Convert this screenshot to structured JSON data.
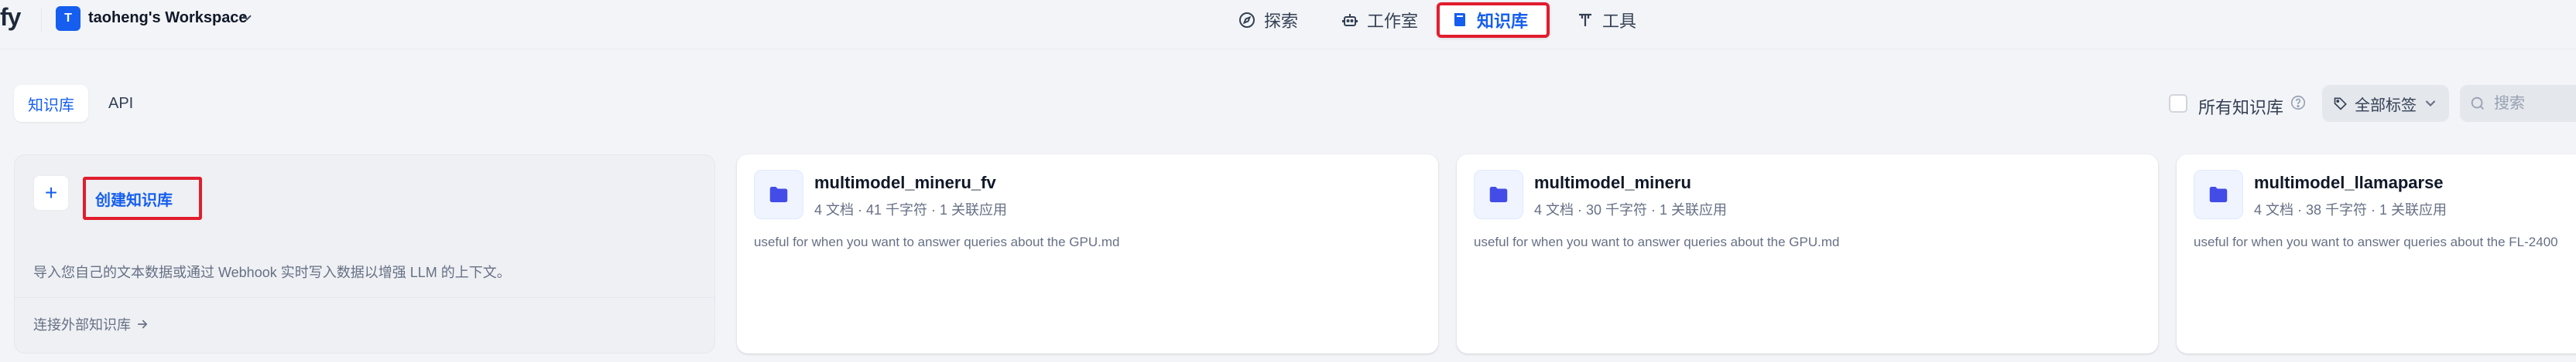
{
  "app": {
    "logo_text": "fy"
  },
  "workspace": {
    "avatar_letter": "T",
    "name": "taoheng's Workspace"
  },
  "nav": {
    "explore": "探索",
    "studio": "工作室",
    "datasets": "知识库",
    "tools": "工具"
  },
  "tabs": {
    "datasets": "知识库",
    "api": "API"
  },
  "filters": {
    "all_datasets_label": "所有知识库",
    "all_datasets_checked": false,
    "tags_label": "全部标签",
    "search_placeholder": "搜索"
  },
  "create_card": {
    "plus": "+",
    "title": "创建知识库",
    "description": "导入您自己的文本数据或通过 Webhook 实时写入数据以增强 LLM 的上下文。",
    "connect_link": "连接外部知识库"
  },
  "datasets": [
    {
      "name": "multimodel_mineru_fv",
      "meta": "4 文档 · 41 千字符 · 1 关联应用",
      "description": "useful for when you want to answer queries about the GPU.md"
    },
    {
      "name": "multimodel_mineru",
      "meta": "4 文档 · 30 千字符 · 1 关联应用",
      "description": "useful for when you want to answer queries about the GPU.md"
    },
    {
      "name": "multimodel_llamaparse",
      "meta": "4 文档 · 38 千字符 · 1 关联应用",
      "description": "useful for when you want to answer queries about the FL-2400"
    }
  ],
  "colors": {
    "accent": "#155eef",
    "highlight_border": "#e11d2e",
    "background": "#f2f4f7"
  }
}
